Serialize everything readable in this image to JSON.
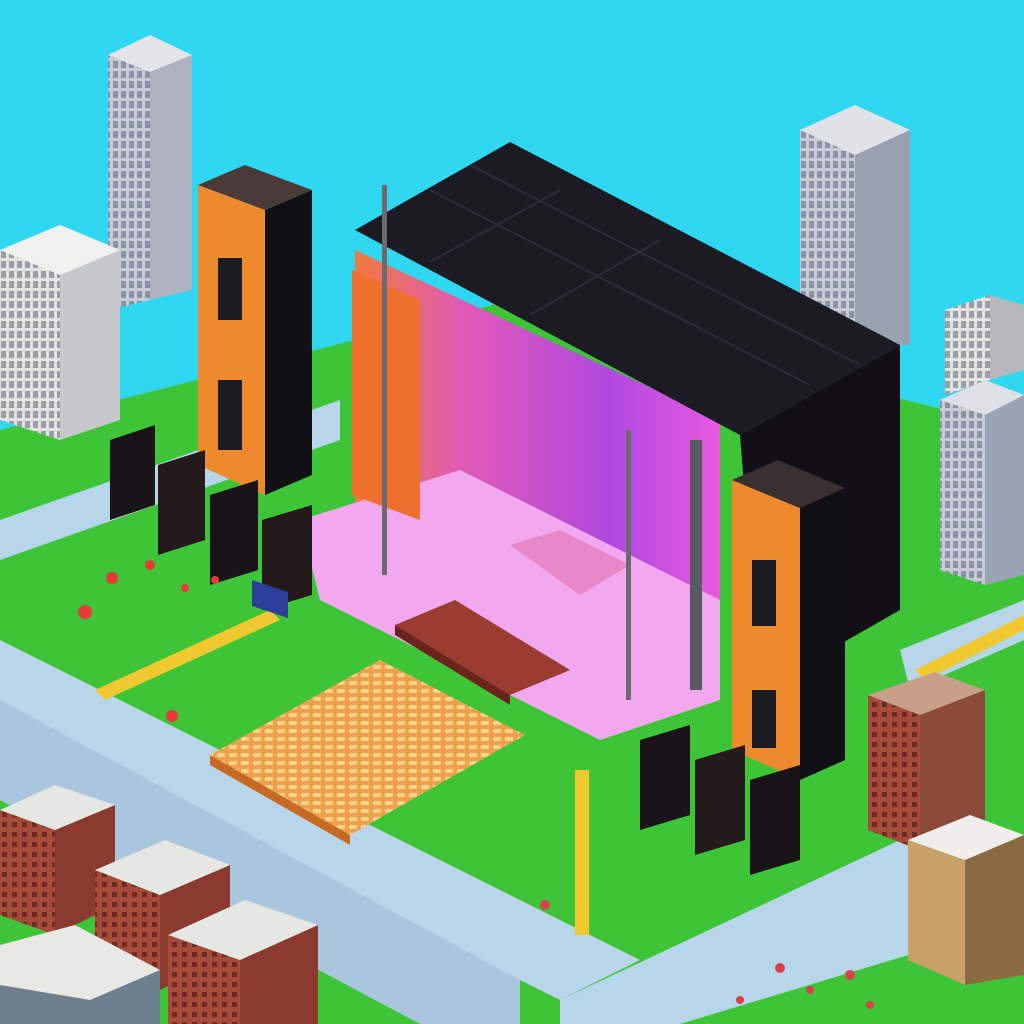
{
  "scene": {
    "description_colors": {
      "sky": "#2fd8f0",
      "grass": "#3ec437",
      "road": "#b8d6ea",
      "path": "#f0c830",
      "roof_dark": "#1c1a22",
      "stage_pink": "#f2a8ee",
      "stage_magenta": "#c43fd0",
      "tower_orange": "#ee8a2e",
      "seating_orange": "#f0a048",
      "brick": "#a84a3a",
      "glass_tower": "#c9ccd4",
      "concrete": "#e8e6e0"
    }
  }
}
